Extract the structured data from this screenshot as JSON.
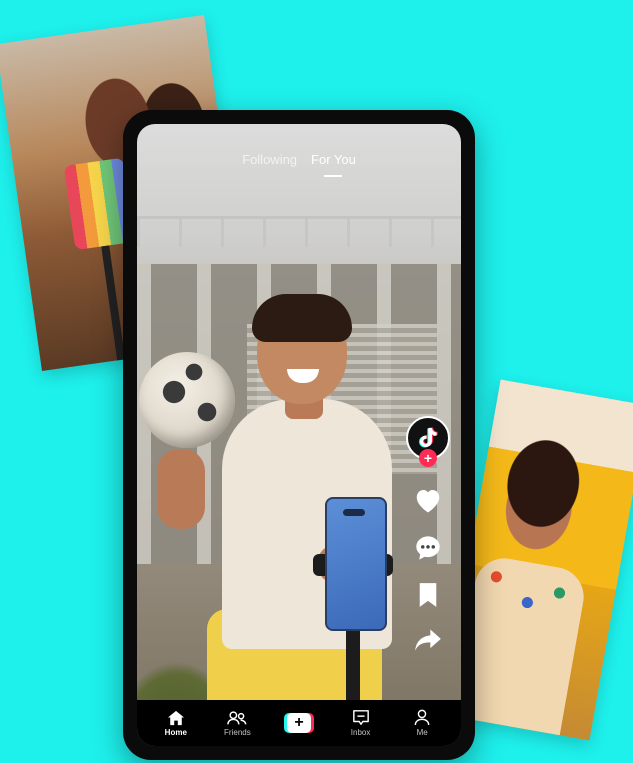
{
  "top_tabs": [
    {
      "label": "Following",
      "active": false
    },
    {
      "label": "For You",
      "active": true
    }
  ],
  "rail": {
    "avatar_icon": "tiktok-logo-icon",
    "follow_badge": "+",
    "actions": [
      "heart-icon",
      "comment-icon",
      "bookmark-icon",
      "share-icon"
    ]
  },
  "bottom_nav": {
    "home": "Home",
    "friends": "Friends",
    "create": "+",
    "inbox": "Inbox",
    "me": "Me"
  },
  "colors": {
    "background": "#1ef0ec",
    "brand_cyan": "#25f4ee",
    "brand_red": "#fe2c55"
  }
}
